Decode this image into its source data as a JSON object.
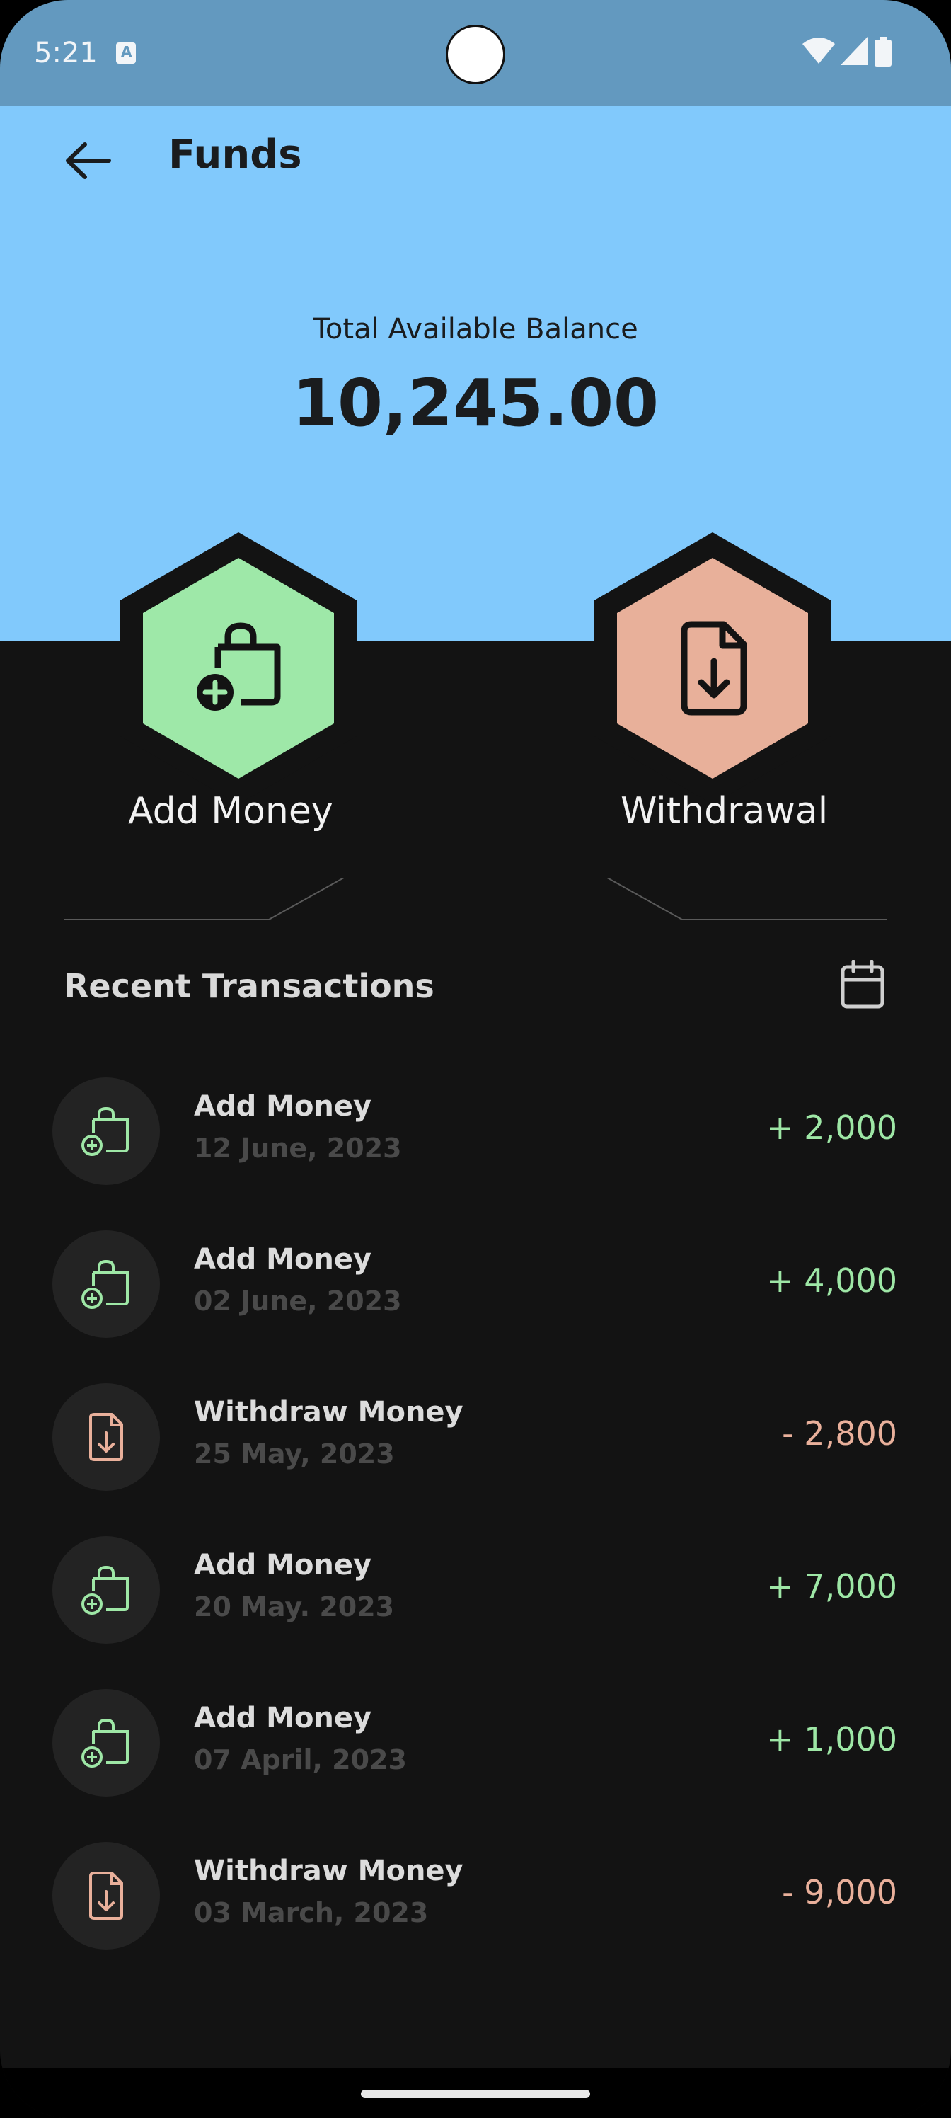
{
  "status_bar": {
    "time": "5:21"
  },
  "header": {
    "title": "Funds",
    "back_icon": "arrow-left-icon"
  },
  "balance": {
    "label": "Total Available Balance",
    "value": "10,245.00"
  },
  "actions": {
    "add_money": {
      "label": "Add Money",
      "color": "#9ee8a8",
      "icon": "bag-plus-icon"
    },
    "withdrawal": {
      "label": "Withdrawal",
      "color": "#e8b09a",
      "icon": "file-download-icon"
    }
  },
  "recent": {
    "title": "Recent Transactions",
    "filter_icon": "calendar-icon"
  },
  "transactions": [
    {
      "title": "Add Money",
      "date": "12 June, 2023",
      "amount": "+ 2,000",
      "type": "add"
    },
    {
      "title": "Add Money",
      "date": "02 June, 2023",
      "amount": "+ 4,000",
      "type": "add"
    },
    {
      "title": "Withdraw Money",
      "date": "25 May, 2023",
      "amount": "- 2,800",
      "type": "withdraw"
    },
    {
      "title": "Add Money",
      "date": "20 May. 2023",
      "amount": "+ 7,000",
      "type": "add"
    },
    {
      "title": "Add Money",
      "date": "07 April, 2023",
      "amount": "+ 1,000",
      "type": "add"
    },
    {
      "title": "Withdraw Money",
      "date": "03 March, 2023",
      "amount": "- 9,000",
      "type": "withdraw"
    }
  ],
  "colors": {
    "header_bg": "#81c9fc",
    "status_bg": "#6399bf",
    "body_bg": "#131313",
    "positive": "#9ee7a6",
    "negative": "#e9b09b"
  }
}
